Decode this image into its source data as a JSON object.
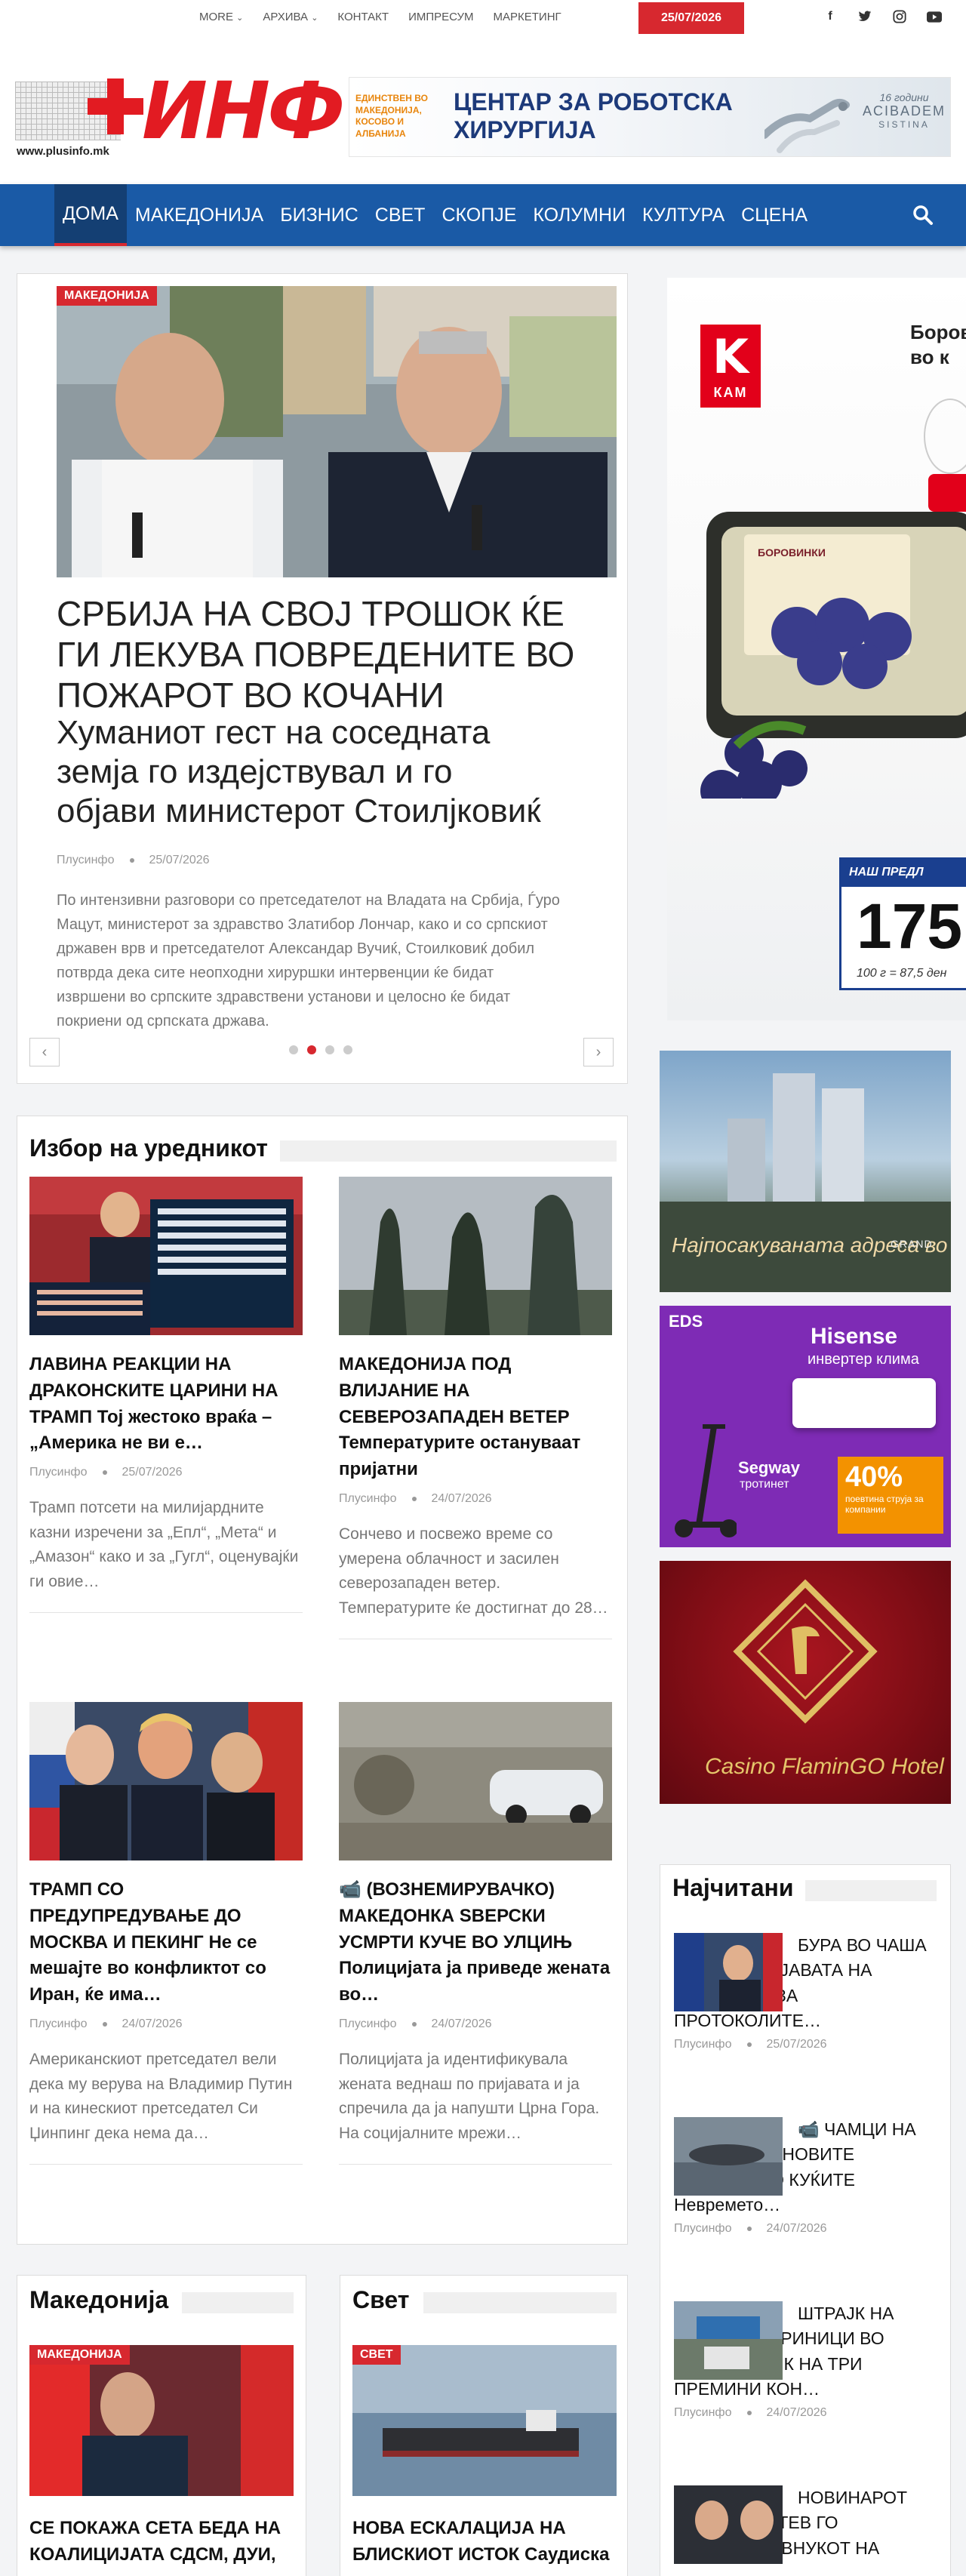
{
  "topnav": {
    "items": [
      "MORE",
      "АРХИВА",
      "КОНТАКТ",
      "ИМПРЕСУМ",
      "МАРКЕТИНГ"
    ],
    "date": "25/07/2026",
    "social": [
      "f",
      "t",
      "ig",
      "yt"
    ]
  },
  "header": {
    "logo_text": "ИНФ",
    "logo_url": "www.plusinfo.mk",
    "banner": {
      "small_text": "ЕДИНСТВЕН ВО МАКЕДОНИЈА, КОСОВО И АЛБАНИЈА",
      "title_line1": "ЦЕНТАР ЗА РОБОТСКА",
      "title_line2": "ХИРУРГИЈА",
      "years": "16 години",
      "brand": "ACIBADEM",
      "brand_sub": "SISTINA"
    }
  },
  "mainnav": {
    "items": [
      "ДОМА",
      "МАКЕДОНИЈА",
      "БИЗНИС",
      "СВЕТ",
      "СКОПЈЕ",
      "КОЛУМНИ",
      "КУЛТУРА",
      "СЦЕНА"
    ],
    "active": "ДОМА"
  },
  "featured": {
    "tag": "МАКЕДОНИЈА",
    "title_lines": [
      "СРБИЈА НА СВОЈ ТРОШОК ЌЕ",
      "ГИ ЛЕКУВА ПОВРЕДЕНИТЕ ВО",
      "ПОЖАРОТ ВО КОЧАНИ"
    ],
    "subtitle_lines": [
      "Хуманиот гест на соседната",
      "земја го издејствувал и го",
      "објави министерот Стоилјковиќ"
    ],
    "author": "Плусинфо",
    "date": "25/07/2026",
    "excerpt_lines": [
      "По интензивни разговори со претседателот на Владата на Србија, Ѓуро",
      "Мацут, министерот за здравство Златибор Лончар, како и со српскиот",
      "државен врв и претседателот Александар Вучиќ, Стоилковиќ добил",
      "потврда дека сите неопходни хируршки интервенции ќе бидат",
      "извршени во српските здравствени установи и целосно ќе бидат",
      "покриени од српската држава."
    ],
    "prev": "‹",
    "next": "›",
    "dots": 4,
    "active_dot": 1
  },
  "editor": {
    "title": "Избор на уредникот",
    "posts": [
      {
        "title": "ЛАВИНА РЕАКЦИИ НА ДРАКОНСКИТЕ ЦАРИНИ НА ТРАМП Тој жестоко враќа – „Америка не ви е…",
        "author": "Плусинфо",
        "date": "25/07/2026",
        "excerpt": "Трамп потсети на милијардните казни изречени за „Епл“, „Мета“ и „Амазон“ како и за „Гугл“, оценувајќи ги овие…"
      },
      {
        "title": "МАКЕДОНИЈА ПОД ВЛИЈАНИЕ НА СЕВЕРОЗАПАДЕН ВЕТЕР Температурите остануваат пријатни",
        "author": "Плусинфо",
        "date": "24/07/2026",
        "excerpt": "Сончево и посвежо време со умерена облачност и засилен северозападен ветер. Температурите ќе достигнат до 28…"
      },
      {
        "title": "ТРАМП СО ПРЕДУПРЕДУВАЊЕ ДО МОСКВА И ПЕКИНГ Не се мешајте во конфликтот со Иран, ќе има…",
        "author": "Плусинфо",
        "date": "24/07/2026",
        "excerpt": "Американскиот претседател вели дека му верува на Владимир Путин и на кинескиот претседател Си Џинпинг дека нема да…"
      },
      {
        "title": "(ВОЗНЕМИРУВАЧКО) МАКЕДОНКА SВЕРСКИ УСМРТИ КУЧЕ ВО УЛЦИЊ Полицијата ја приведе жената во…",
        "author": "Плусинфо",
        "date": "24/07/2026",
        "excerpt": "Полицијата ја идентификувала жената веднаш по пријавата и ја спречила да ја напушти Црна Гора. На социјалните мрежи…"
      }
    ]
  },
  "sidebar": {
    "ad_main": {
      "logo_k": "K",
      "logo_kam": "КАМ",
      "headline": "Боров\nво к",
      "pack_label": "БОРОВИНКИ",
      "tag_header": "НАШ ПРЕДЛ",
      "price": "175",
      "unit": "100 г = 87,5 ден"
    },
    "ad_building": {
      "caption": "Најпосакуваната адреса во градот",
      "brand": "GRAND"
    },
    "ad_eds": {
      "eds": "EDS",
      "hisense": "Hisense",
      "inverter": "инвертер клима",
      "segway": "Segway",
      "trotinet": "тротинет",
      "promo_pct": "40%",
      "promo_text": "поевтина струја за компании"
    },
    "ad_casino": {
      "text": "Casino FlaminGO Hotel"
    },
    "popular": {
      "title": "Најчитани",
      "items": [
        {
          "text": "БУРА ВО ЧАША ВОДА ПО ИЗЈАВАТА НА МУЦУНСКИ ЗА ПРОТОКОЛИТЕ…",
          "author": "Плусинфо",
          "date": "25/07/2026"
        },
        {
          "text": "ЧАМЦИ НА БРЕГОТ, БРАНОВИТЕ СТИГНАА ДО КУЌИТЕ Невремето…",
          "author": "Плусинфо",
          "date": "24/07/2026"
        },
        {
          "text": "ШТРАЈК НА ГРЧКИТЕ ЦАРИНИЦИ ВО ПОНЕДЕЛНИК НА ТРИ ПРЕМИНИ КОН…",
          "author": "Плусинфо",
          "date": "24/07/2026"
        },
        {
          "text": "НОВИНАРОТ ЉУПЧО ЗЛАТЕВ ГО РАСКРИНКА ВНУКОТ НА",
          "author": "",
          "date": ""
        }
      ]
    }
  },
  "bottom": {
    "mk": {
      "title": "Македонија",
      "tag": "МАКЕДОНИЈА",
      "headline": "СЕ ПОКАЖА СЕТА БЕДА НА КОАЛИЦИЈАТА СДСМ, ДУИ,"
    },
    "svet": {
      "title": "Свет",
      "tag": "СВЕТ",
      "headline": "НОВА ЕСКАЛАЦИЈА НА БЛИСКИОТ ИСТОК Саудиска"
    }
  },
  "colors": {
    "brand_blue": "#1a5aa6",
    "accent_red": "#d7282f"
  }
}
